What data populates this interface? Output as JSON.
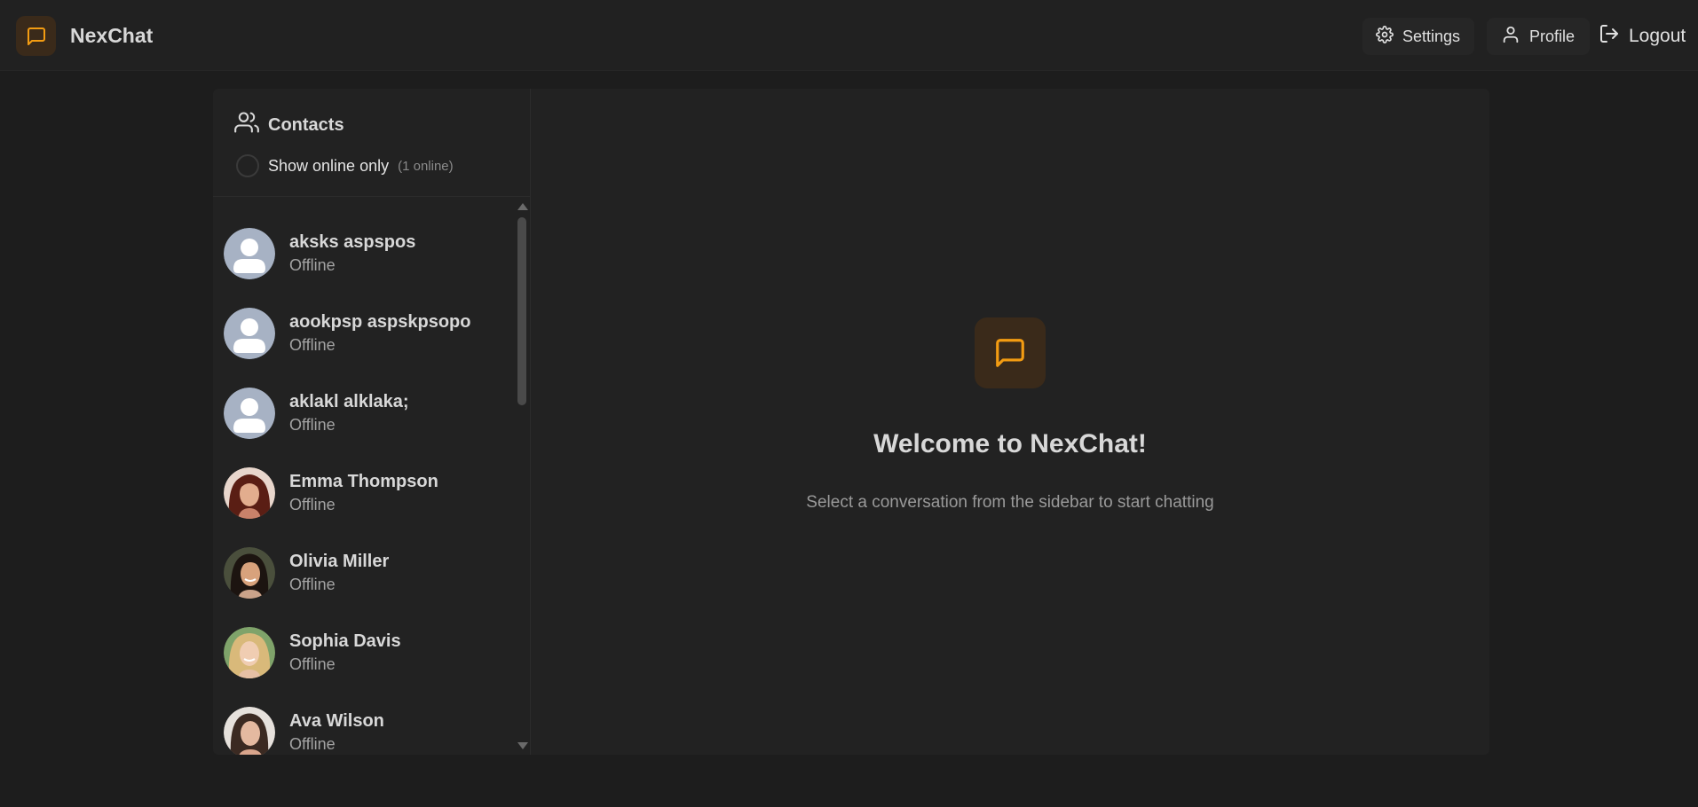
{
  "app": {
    "name": "NexChat",
    "accent": "#f39c12"
  },
  "nav": {
    "settings_label": "Settings",
    "profile_label": "Profile",
    "logout_label": "Logout"
  },
  "sidebar": {
    "title": "Contacts",
    "filter_label": "Show online only",
    "online_count": "(1 online)",
    "contacts": [
      {
        "name": "aksks aspspos",
        "status": "Offline",
        "avatar": "default"
      },
      {
        "name": "aookpsp aspskpsopo",
        "status": "Offline",
        "avatar": "default"
      },
      {
        "name": "aklakl alklaka;",
        "status": "Offline",
        "avatar": "default"
      },
      {
        "name": "Emma Thompson",
        "status": "Offline",
        "avatar": "photo"
      },
      {
        "name": "Olivia Miller",
        "status": "Offline",
        "avatar": "photo"
      },
      {
        "name": "Sophia Davis",
        "status": "Offline",
        "avatar": "photo"
      },
      {
        "name": "Ava Wilson",
        "status": "Offline",
        "avatar": "photo"
      }
    ]
  },
  "welcome": {
    "title": "Welcome to NexChat!",
    "subtitle": "Select a conversation from the sidebar to start chatting"
  },
  "icons": {
    "brand": "message-square-icon",
    "settings": "gear-icon",
    "profile": "user-icon",
    "logout": "logout-icon",
    "contacts": "users-icon"
  }
}
